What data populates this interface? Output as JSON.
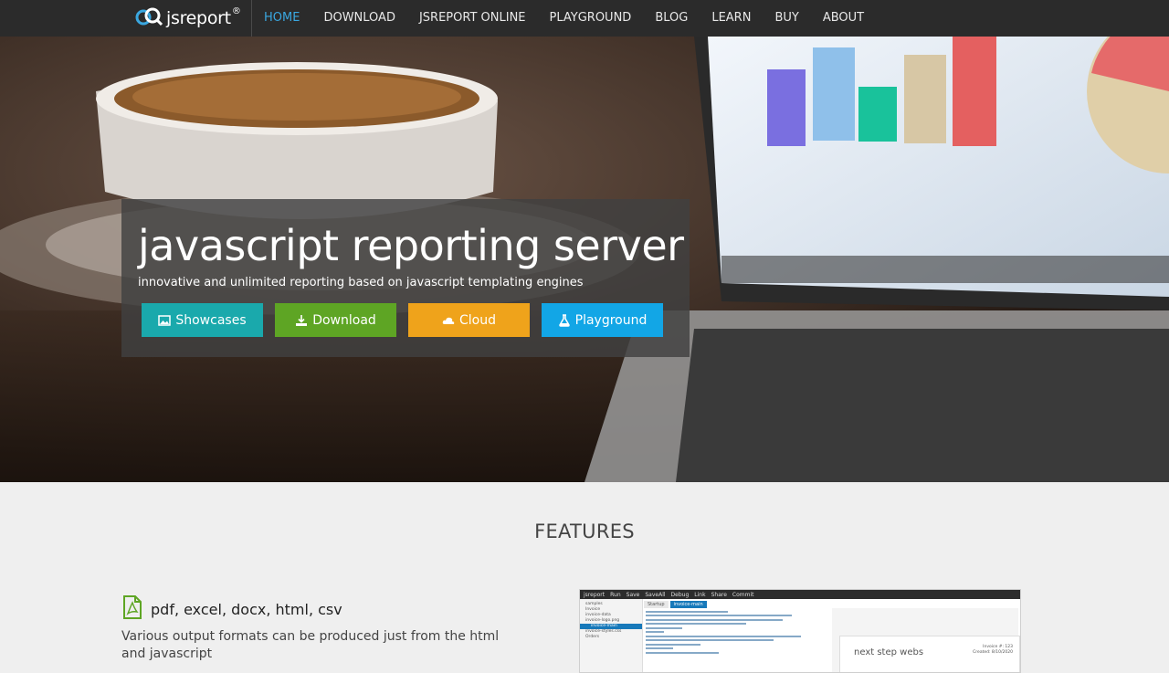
{
  "nav": {
    "brand": "jsreport",
    "brand_mark": "®",
    "items": [
      {
        "label": "HOME",
        "active": true
      },
      {
        "label": "DOWNLOAD"
      },
      {
        "label": "JSREPORT ONLINE"
      },
      {
        "label": "PLAYGROUND"
      },
      {
        "label": "BLOG"
      },
      {
        "label": "LEARN"
      },
      {
        "label": "BUY"
      },
      {
        "label": "ABOUT"
      }
    ]
  },
  "hero": {
    "title": "javascript reporting server",
    "subtitle": "innovative and unlimited reporting based on javascript templating engines",
    "buttons": [
      {
        "label": "Showcases",
        "icon": "image-icon",
        "color": "#1aa9ac"
      },
      {
        "label": "Download",
        "icon": "download-icon",
        "color": "#5ea524"
      },
      {
        "label": "Cloud",
        "icon": "cloud-icon",
        "color": "#efa31b"
      },
      {
        "label": "Playground",
        "icon": "flask-icon",
        "color": "#12a6e6"
      }
    ]
  },
  "features": {
    "heading": "FEATURES",
    "items": [
      {
        "icon": "pdf-file-icon",
        "title": "pdf, excel, docx, html, csv",
        "description": "Various output formats can be produced just from the html and javascript"
      }
    ]
  },
  "screenshot": {
    "brand": "jsreport",
    "toolbar": [
      "Run",
      "Save",
      "SaveAll",
      "Debug",
      "Link",
      "Share",
      "Commit"
    ],
    "tabs": [
      "Startup",
      "invoice-main"
    ],
    "tree": [
      "samples",
      "Invoice",
      "invoice-data",
      "invoice-logo.png",
      "invoice-main",
      "invoice-styles.css",
      "Orders"
    ],
    "preview_brand": "next step webs",
    "preview_invoice": [
      "Invoice #: 123",
      "Created: 8/10/2020"
    ]
  },
  "colors": {
    "nav_bg": "#2b2b2b",
    "nav_active": "#3aa7e0",
    "page_bg": "#efefef",
    "feature_icon": "#5ea524"
  }
}
